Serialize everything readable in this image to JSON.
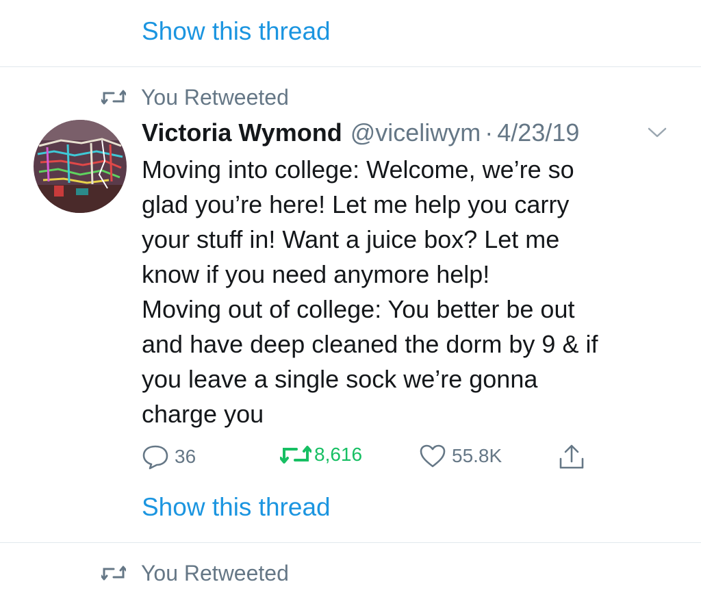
{
  "top_thread_link": "Show this thread",
  "retweet_label": "You Retweeted",
  "tweet": {
    "author_name": "Victoria Wymond",
    "author_handle": "@viceliwym",
    "separator": "·",
    "date": "4/23/19",
    "text_lines": [
      "Moving into college: Welcome, we’re so",
      "glad you’re here! Let me help you carry",
      "your stuff in! Want a juice box? Let me",
      "know if you need anymore help!",
      "Moving out of college: You better be out",
      "and have deep cleaned the dorm by 9 & if",
      "you leave a single sock we’re gonna",
      "charge you"
    ],
    "replies": "36",
    "retweets": "8,616",
    "likes": "55.8K",
    "show_thread": "Show this thread",
    "retweeted_by_you": true
  },
  "next_retweet_label": "You Retweeted",
  "colors": {
    "link": "#1b95e0",
    "secondary_text": "#657786",
    "retweet_active": "#17bf63",
    "divider": "#e1e8ed"
  },
  "icons": {
    "retweet_indicator": "retweet-icon",
    "caret": "chevron-down-icon",
    "reply": "reply-icon",
    "retweet": "retweet-icon",
    "like": "heart-icon",
    "share": "share-icon"
  }
}
